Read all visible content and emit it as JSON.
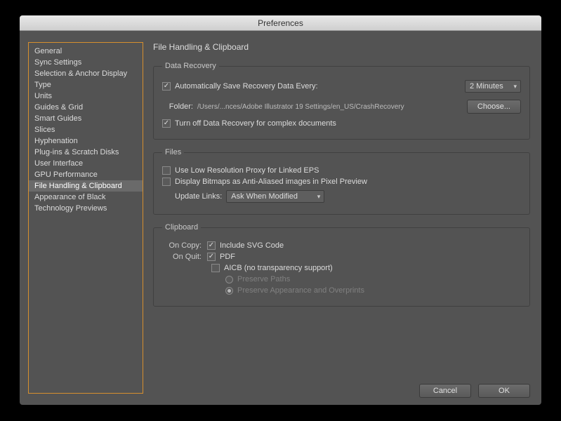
{
  "window": {
    "title": "Preferences"
  },
  "sidebar": {
    "items": [
      {
        "label": "General"
      },
      {
        "label": "Sync Settings"
      },
      {
        "label": "Selection & Anchor Display"
      },
      {
        "label": "Type"
      },
      {
        "label": "Units"
      },
      {
        "label": "Guides & Grid"
      },
      {
        "label": "Smart Guides"
      },
      {
        "label": "Slices"
      },
      {
        "label": "Hyphenation"
      },
      {
        "label": "Plug-ins & Scratch Disks"
      },
      {
        "label": "User Interface"
      },
      {
        "label": "GPU Performance"
      },
      {
        "label": "File Handling & Clipboard"
      },
      {
        "label": "Appearance of Black"
      },
      {
        "label": "Technology Previews"
      }
    ],
    "selected_index": 12
  },
  "panel": {
    "title": "File Handling & Clipboard",
    "data_recovery": {
      "legend": "Data Recovery",
      "auto_save_label": "Automatically Save Recovery Data Every:",
      "auto_save_checked": true,
      "interval": "2 Minutes",
      "folder_label": "Folder:",
      "folder_path": "/Users/...nces/Adobe Illustrator 19 Settings/en_US/CrashRecovery",
      "choose_label": "Choose...",
      "turn_off_label": "Turn off Data Recovery for complex documents",
      "turn_off_checked": true
    },
    "files": {
      "legend": "Files",
      "low_res_label": "Use Low Resolution Proxy for Linked EPS",
      "low_res_checked": false,
      "bitmaps_label": "Display Bitmaps as Anti-Aliased images in Pixel Preview",
      "bitmaps_checked": false,
      "update_links_label": "Update Links:",
      "update_links_value": "Ask When Modified"
    },
    "clipboard": {
      "legend": "Clipboard",
      "on_copy_label": "On Copy:",
      "svg_label": "Include SVG Code",
      "svg_checked": true,
      "on_quit_label": "On Quit:",
      "pdf_label": "PDF",
      "pdf_checked": true,
      "aicb_label": "AICB (no transparency support)",
      "aicb_checked": false,
      "preserve_paths_label": "Preserve Paths",
      "preserve_paths_selected": false,
      "preserve_appearance_label": "Preserve Appearance and Overprints",
      "preserve_appearance_selected": true
    }
  },
  "footer": {
    "cancel": "Cancel",
    "ok": "OK"
  }
}
